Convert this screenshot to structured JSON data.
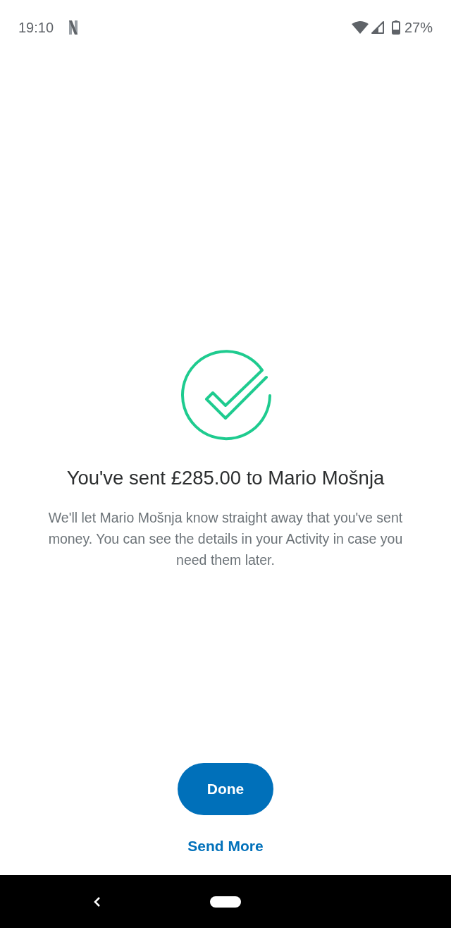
{
  "status_bar": {
    "time": "19:10",
    "battery": "27%"
  },
  "confirmation": {
    "title": "You've sent £285.00 to Mario Mošnja",
    "message": "We'll let Mario Mošnja know straight away that you've sent money. You can see the details in your Activity in case you need them later."
  },
  "buttons": [
    {
      "label": "Done",
      "kind": "primary"
    },
    {
      "label": "Send More",
      "kind": "link"
    }
  ]
}
